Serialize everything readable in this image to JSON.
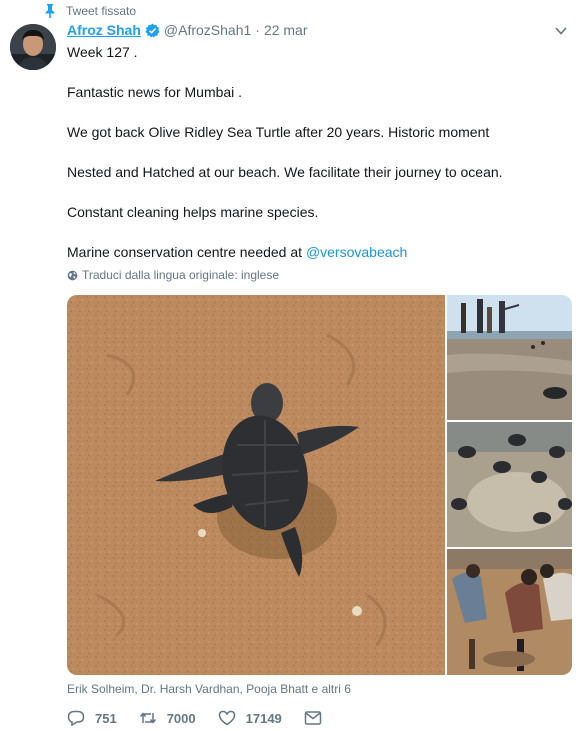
{
  "pinned": {
    "label": "Tweet fissato"
  },
  "author": {
    "name": "Afroz Shah",
    "handle": "@AfrozShah1",
    "separator": "·",
    "date": "22 mar"
  },
  "tweet": {
    "lines": [
      "Week 127 .",
      "Fantastic news for Mumbai .",
      "We got back Olive Ridley Sea Turtle after 20 years. Historic moment",
      "Nested and Hatched at  our beach. We facilitate their journey to ocean.",
      "Constant cleaning helps marine species."
    ],
    "last_line_prefix": "Marine conservation centre needed at ",
    "mention": "@versovabeach"
  },
  "translate": {
    "label": "Traduci dalla lingua originale: inglese"
  },
  "likers": "Erik Solheim, Dr. Harsh Vardhan, Pooja Bhatt e altri 6",
  "actions": {
    "replies": "751",
    "retweets": "7000",
    "likes": "17149"
  },
  "colors": {
    "link": "#1da1f2",
    "muted": "#657786",
    "pin": "#1da1f2"
  },
  "icons": [
    "pin-icon",
    "verified-badge-icon",
    "chevron-down-icon",
    "globe-icon",
    "reply-icon",
    "retweet-icon",
    "like-icon",
    "message-icon"
  ]
}
